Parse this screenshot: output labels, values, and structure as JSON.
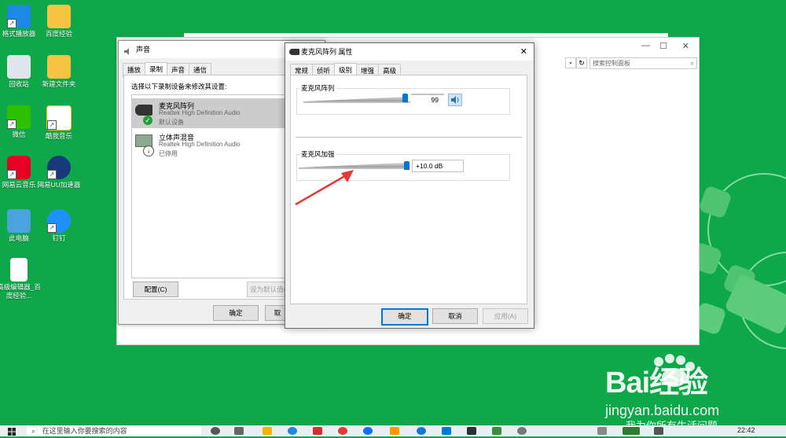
{
  "desktop_icons": [
    {
      "label": "格式播放器"
    },
    {
      "label": "百度经验"
    },
    {
      "label": "回收站"
    },
    {
      "label": "新建文件夹"
    },
    {
      "label": "微信"
    },
    {
      "label": "酷我音乐"
    },
    {
      "label": "网易云音乐"
    },
    {
      "label": "网易UU加速器"
    },
    {
      "label": "此电脑"
    },
    {
      "label": "钉钉"
    },
    {
      "label": "高级编辑器_百度经验..."
    }
  ],
  "control_panel": {
    "search_placeholder": "搜索控制面板",
    "window_buttons": {
      "minimize": "—",
      "maximize": "☐",
      "close": "✕"
    }
  },
  "sound_dialog": {
    "title": "声音",
    "tabs": [
      "播放",
      "录制",
      "声音",
      "通信"
    ],
    "selected_tab": "录制",
    "instruction": "选择以下录制设备来修改其设置:",
    "devices": [
      {
        "name": "麦克风阵列",
        "driver": "Realtek High Definition Audio",
        "status": "默认设备"
      },
      {
        "name": "立体声混音",
        "driver": "Realtek High Definition Audio",
        "status": "已停用"
      }
    ],
    "configure_button": "配置(C)",
    "set_default_button": "设为默认值(S)",
    "ok_button": "确定",
    "cancel_button": "取"
  },
  "properties_dialog": {
    "title": "麦克风阵列 属性",
    "tabs": [
      "常规",
      "侦听",
      "级别",
      "增强",
      "高级"
    ],
    "selected_tab": "级别",
    "mic_array": {
      "label": "麦克风阵列",
      "value": "99",
      "level_percent": 99
    },
    "mic_boost": {
      "label": "麦克风加强",
      "value": "+10.0 dB",
      "level_fraction": 1.0
    },
    "ok_button": "确定",
    "cancel_button": "取消",
    "apply_button": "应用(A)"
  },
  "taskbar": {
    "search_placeholder": "在这里输入你要搜索的内容",
    "clock": "22:42"
  },
  "watermark": {
    "brand": "Bai经验",
    "url": "jingyan.baidu.com",
    "slogan": "我为你所有生活问题"
  },
  "colors": {
    "desktop": "#0ea84a",
    "accent": "#0078d7",
    "annotation_arrow": "#e53935"
  }
}
